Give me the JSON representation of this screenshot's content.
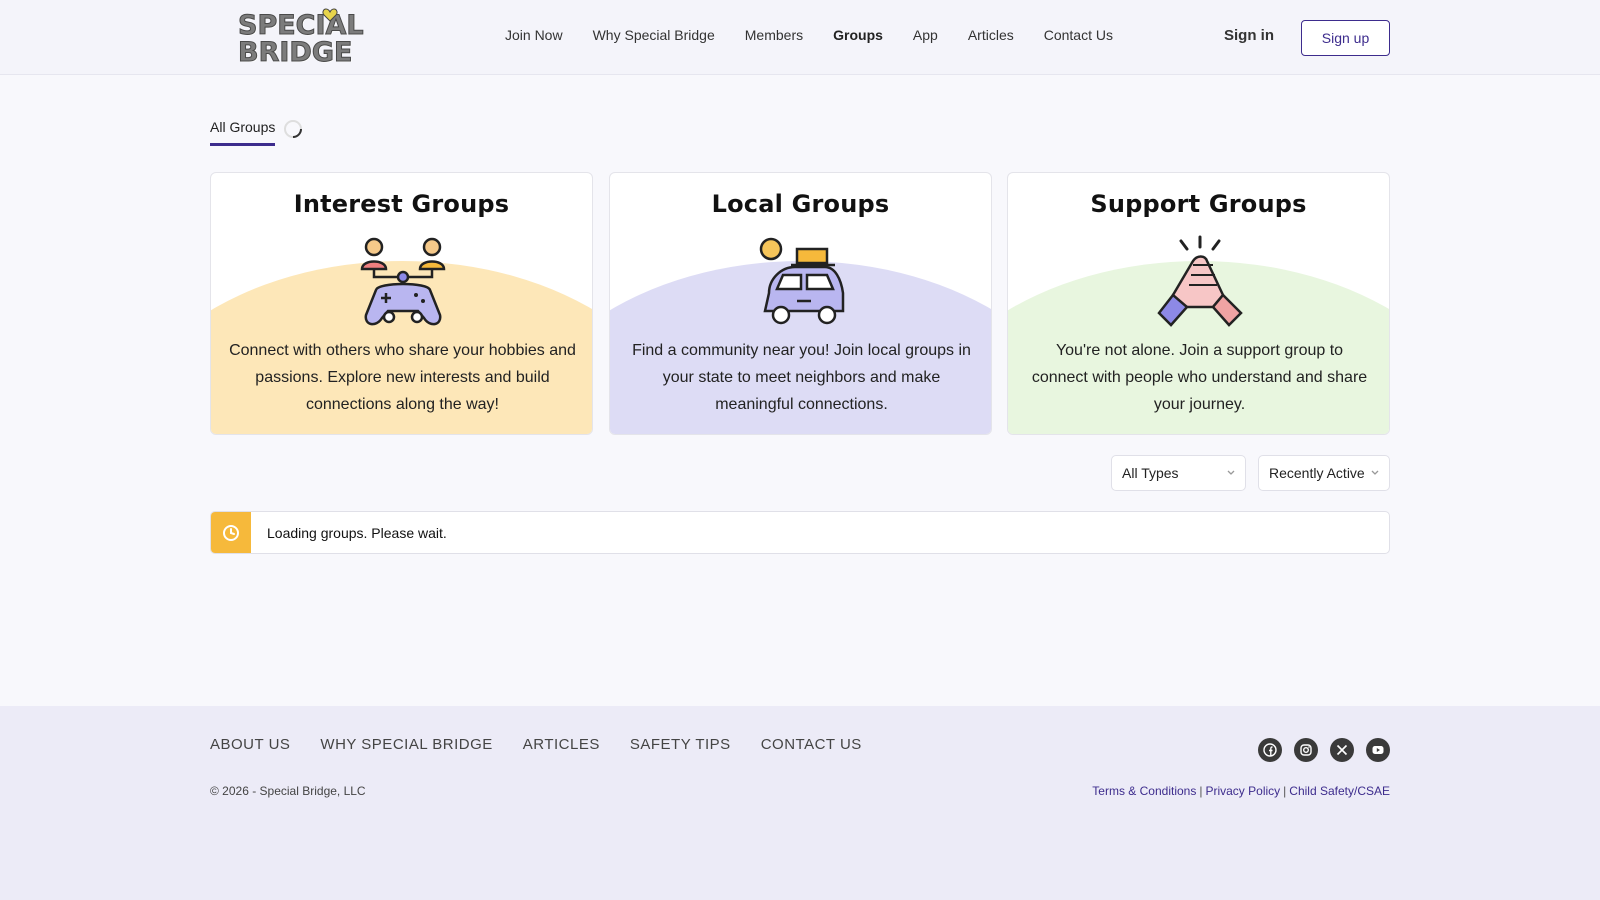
{
  "header": {
    "logo_line1": "SPECIAL",
    "logo_line2": "BRIDGE",
    "nav": [
      "Join Now",
      "Why Special Bridge",
      "Members",
      "Groups",
      "App",
      "Articles",
      "Contact Us"
    ],
    "active_nav": "Groups",
    "signin_label": "Sign in",
    "signup_label": "Sign up"
  },
  "tabs": {
    "all_groups_label": "All Groups"
  },
  "cards": [
    {
      "title": "Interest Groups",
      "description": "Connect with others who share your hobbies and passions. Explore new interests and build connections along the way!",
      "icon": "gamepad-people-icon",
      "color": "#fde7b8"
    },
    {
      "title": "Local Groups",
      "description": "Find a community near you! Join local groups in your state to meet neighbors and make meaningful connections.",
      "icon": "car-travel-icon",
      "color": "#dddcf5"
    },
    {
      "title": "Support Groups",
      "description": "You're not alone. Join a support group to connect with people who understand and share your journey.",
      "icon": "handshake-icon",
      "color": "#e8f6df"
    }
  ],
  "filters": {
    "type_value": "All Types",
    "sort_value": "Recently Active"
  },
  "status": {
    "loading_text": "Loading groups. Please wait.",
    "icon": "clock-icon"
  },
  "footer": {
    "links": [
      "ABOUT US",
      "WHY SPECIAL BRIDGE",
      "ARTICLES",
      "SAFETY TIPS",
      "CONTACT US"
    ],
    "social": [
      "facebook-icon",
      "instagram-icon",
      "x-icon",
      "youtube-icon"
    ],
    "copyright": "© 2026 - Special Bridge, LLC",
    "legal": [
      "Terms & Conditions",
      "Privacy Policy",
      "Child Safety/CSAE"
    ]
  },
  "colors": {
    "accent": "#3d2c8d",
    "alert": "#f6b93b"
  }
}
